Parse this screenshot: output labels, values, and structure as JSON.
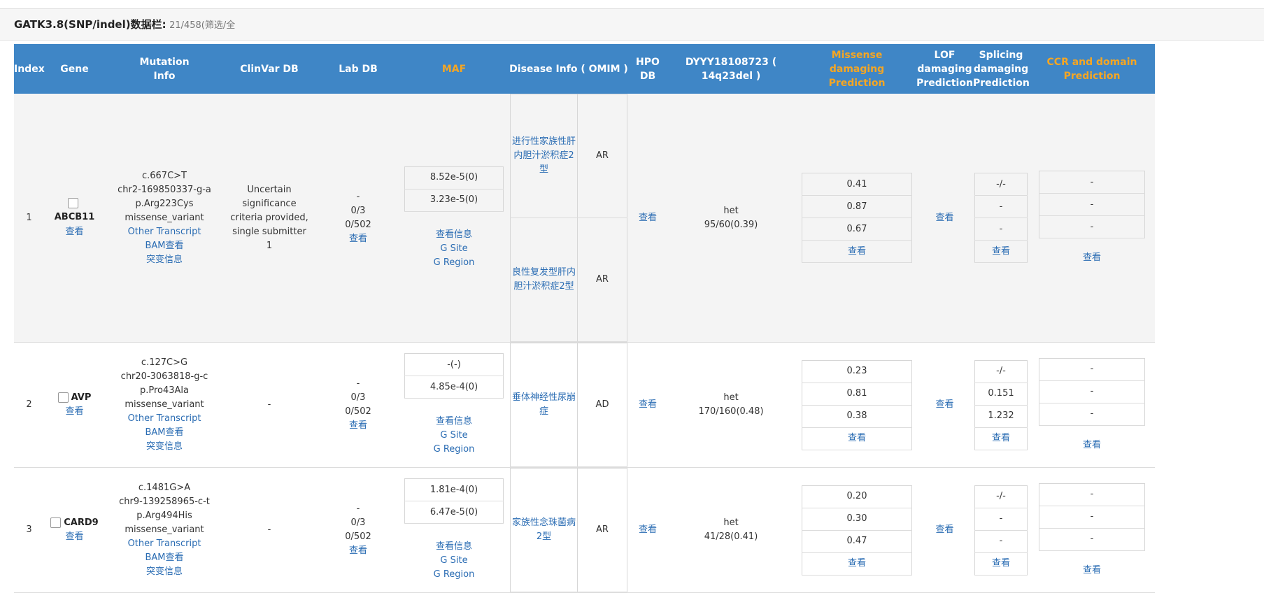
{
  "panel": {
    "title": "GATK3.8(SNP/indel)数据栏:",
    "count": "21/458(筛选/全"
  },
  "columns": {
    "index": "Index",
    "gene": "Gene",
    "mutation_line1": "Mutation",
    "mutation_line2": "Info",
    "clinvar": "ClinVar DB",
    "lab": "Lab DB",
    "maf": "MAF",
    "disease": "Disease Info ( OMIM )",
    "hpo": "HPO DB",
    "sample": "DYYY18108723 ( 14q23del )",
    "missense_line1": "Missense",
    "missense_line2": "damaging",
    "missense_line3": "Prediction",
    "lof_line1": "LOF",
    "lof_line2": "damaging",
    "lof_line3": "Prediction",
    "splicing_line1": "Splicing",
    "splicing_line2": "damaging",
    "splicing_line3": "Prediction",
    "ccr_line1": "CCR and domain",
    "ccr_line2": "Prediction"
  },
  "links": {
    "view": "查看",
    "view_info": "查看信息",
    "g_site": "G Site",
    "g_region": "G Region",
    "other_transcript": "Other Transcript",
    "bam_view": "BAM查看",
    "mutation_info": "突变信息"
  },
  "rows": [
    {
      "index": "1",
      "gene": "ABCB11",
      "mut": [
        "c.667C>T",
        "chr2-169850337-g-a",
        "p.Arg223Cys",
        "missense_variant"
      ],
      "clinvar": [
        "Uncertain",
        "significance",
        "criteria provided,",
        "single submitter",
        "1"
      ],
      "lab": [
        "-",
        "0/3",
        "0/502"
      ],
      "maf": [
        "8.52e-5(0)",
        "3.23e-5(0)"
      ],
      "disease": [
        {
          "name": "进行性家族性肝内胆汁淤积症2型",
          "mode": "AR"
        },
        {
          "name": "良性复发型肝内胆汁淤积症2型",
          "mode": "AR"
        }
      ],
      "sample": [
        "het",
        "95/60(0.39)"
      ],
      "missense": [
        "0.41",
        "0.87",
        "0.67"
      ],
      "splicing": [
        "-/-",
        "-",
        "-"
      ],
      "ccr": [
        "-",
        "-",
        "-"
      ]
    },
    {
      "index": "2",
      "gene": "AVP",
      "mut": [
        "c.127C>G",
        "chr20-3063818-g-c",
        "p.Pro43Ala",
        "missense_variant"
      ],
      "clinvar": [
        "-"
      ],
      "lab": [
        "-",
        "0/3",
        "0/502"
      ],
      "maf": [
        "-(-)",
        "4.85e-4(0)"
      ],
      "disease": [
        {
          "name": "垂体神经性尿崩症",
          "mode": "AD"
        }
      ],
      "sample": [
        "het",
        "170/160(0.48)"
      ],
      "missense": [
        "0.23",
        "0.81",
        "0.38"
      ],
      "splicing": [
        "-/-",
        "0.151",
        "1.232"
      ],
      "ccr": [
        "-",
        "-",
        "-"
      ]
    },
    {
      "index": "3",
      "gene": "CARD9",
      "mut": [
        "c.1481G>A",
        "chr9-139258965-c-t",
        "p.Arg494His",
        "missense_variant"
      ],
      "clinvar": [
        "-"
      ],
      "lab": [
        "-",
        "0/3",
        "0/502"
      ],
      "maf": [
        "1.81e-4(0)",
        "6.47e-5(0)"
      ],
      "disease": [
        {
          "name": "家族性念珠菌病2型",
          "mode": "AR"
        }
      ],
      "sample": [
        "het",
        "41/28(0.41)"
      ],
      "missense": [
        "0.20",
        "0.30",
        "0.47"
      ],
      "splicing": [
        "-/-",
        "-",
        "-"
      ],
      "ccr": [
        "-",
        "-",
        "-"
      ]
    }
  ]
}
